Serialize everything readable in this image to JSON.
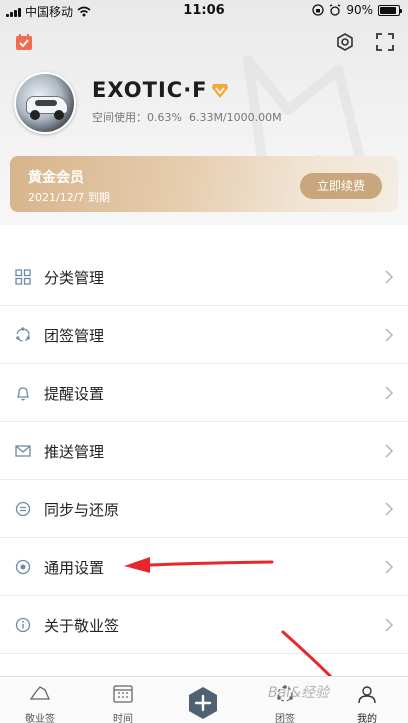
{
  "status_bar": {
    "carrier": "中国移动",
    "time": "11:06",
    "battery_text": "90%",
    "battery_level": 0.9
  },
  "profile": {
    "username": "EXOTIC·F",
    "storage_label": "空间使用：",
    "storage_percent": "0.63%",
    "storage_used": "6.33M/1000.00M"
  },
  "vip": {
    "title": "黄金会员",
    "expire_text": "2021/12/7 到期",
    "renew_label": "立即续费"
  },
  "menu": {
    "items": [
      {
        "label": "分类管理",
        "icon": "grid-icon"
      },
      {
        "label": "团签管理",
        "icon": "team-icon"
      },
      {
        "label": "提醒设置",
        "icon": "bell-icon"
      },
      {
        "label": "推送管理",
        "icon": "mail-icon"
      },
      {
        "label": "同步与还原",
        "icon": "sync-icon"
      },
      {
        "label": "通用设置",
        "icon": "radio-icon"
      },
      {
        "label": "关于敬业签",
        "icon": "info-icon"
      }
    ]
  },
  "tabbar": {
    "tabs": [
      {
        "label": "敬业签",
        "icon": "boat-icon"
      },
      {
        "label": "时间",
        "icon": "calendar-grid-icon"
      },
      {
        "label": "团签",
        "icon": "team-dots-icon"
      },
      {
        "label": "我的",
        "icon": "person-icon",
        "active": true
      }
    ]
  },
  "watermark": "Bai&经验",
  "colors": {
    "accent_gold": "#c9a77c",
    "vip_gradient_start": "#d7b48a",
    "annotation_arrow": "#e8262c",
    "add_button": "#4f6070"
  }
}
